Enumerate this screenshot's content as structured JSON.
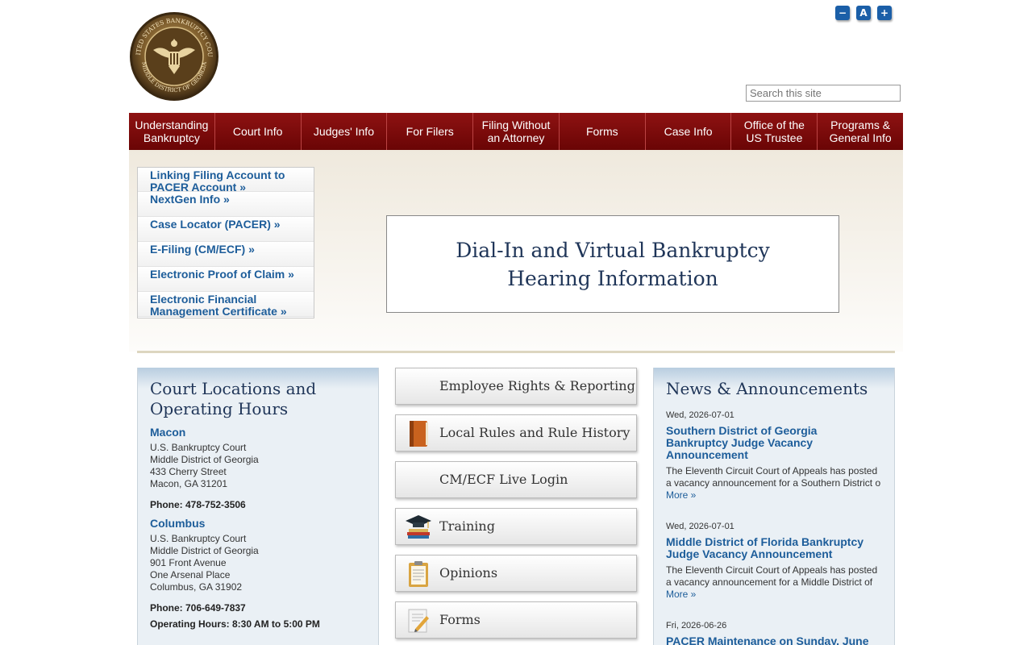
{
  "seal": {
    "ring_text_top": "UNITED STATES BANKRUPTCY COURT",
    "ring_text_bottom": "MIDDLE DISTRICT OF GEORGIA"
  },
  "font_tools": {
    "decrease": "−",
    "reset": "A",
    "increase": "+"
  },
  "search": {
    "placeholder": "Search this site"
  },
  "nav": [
    {
      "label": "Understanding Bankruptcy"
    },
    {
      "label": "Court Info"
    },
    {
      "label": "Judges' Info"
    },
    {
      "label": "For Filers"
    },
    {
      "label": "Filing Without an Attorney"
    },
    {
      "label": "Forms"
    },
    {
      "label": "Case Info"
    },
    {
      "label": "Office of the US Trustee"
    },
    {
      "label": "Programs & General Info"
    }
  ],
  "quick_links": [
    {
      "label": "Linking Filing Account to PACER Account »"
    },
    {
      "label": "NextGen Info »"
    },
    {
      "label": "Case Locator (PACER) »"
    },
    {
      "label": "E-Filing (CM/ECF) »"
    },
    {
      "label": "Electronic Proof of Claim »"
    },
    {
      "label": "Electronic Financial Management Certificate »"
    }
  ],
  "banner": {
    "text": "Dial-In and Virtual Bankruptcy Hearing Information"
  },
  "locations": {
    "title": "Court Locations and Operating Hours",
    "macon": {
      "name": "Macon",
      "line1": "U.S. Bankruptcy Court",
      "line2": "Middle District of Georgia",
      "line3": "433 Cherry Street",
      "line4": "Macon, GA 31201",
      "phone": "Phone: 478-752-3506"
    },
    "columbus": {
      "name": "Columbus",
      "line1": "U.S. Bankruptcy Court",
      "line2": "Middle District of Georgia",
      "line3": "901 Front Avenue",
      "line4": "One Arsenal Place",
      "line5": "Columbus, GA 31902",
      "phone": "Phone: 706-649-7837",
      "hours": "Operating Hours: 8:30 AM to 5:00 PM"
    }
  },
  "tiles": [
    {
      "label": "Employee Rights & Reporting",
      "icon": "none"
    },
    {
      "label": "Local Rules and Rule History",
      "icon": "book-icon"
    },
    {
      "label": "CM/ECF Live Login",
      "icon": "none"
    },
    {
      "label": "Training",
      "icon": "graduation-cap-icon"
    },
    {
      "label": "Opinions",
      "icon": "clipboard-icon"
    },
    {
      "label": "Forms",
      "icon": "pencil-form-icon"
    }
  ],
  "news": {
    "title": "News & Announcements",
    "items": [
      {
        "date": "Wed, 2026-07-01",
        "title": "Southern District of Georgia Bankruptcy Judge Vacancy Announcement",
        "text1": "The Eleventh Circuit Court of Appeals has posted",
        "text2": "a vacancy announcement for a Southern District o",
        "more": "More »"
      },
      {
        "date": "Wed, 2026-07-01",
        "title": "Middle District of Florida Bankruptcy Judge Vacancy Announcement",
        "text1": "The Eleventh Circuit Court of Appeals has posted",
        "text2": "a vacancy announcement for a Middle District of",
        "more": "More »"
      },
      {
        "date": "Fri, 2026-06-26",
        "title": "PACER Maintenance on Sunday, June"
      }
    ]
  },
  "colors": {
    "nav_red": "#7a0a0a",
    "link_blue": "#1d5d9a",
    "heading_navy": "#1f3558"
  }
}
